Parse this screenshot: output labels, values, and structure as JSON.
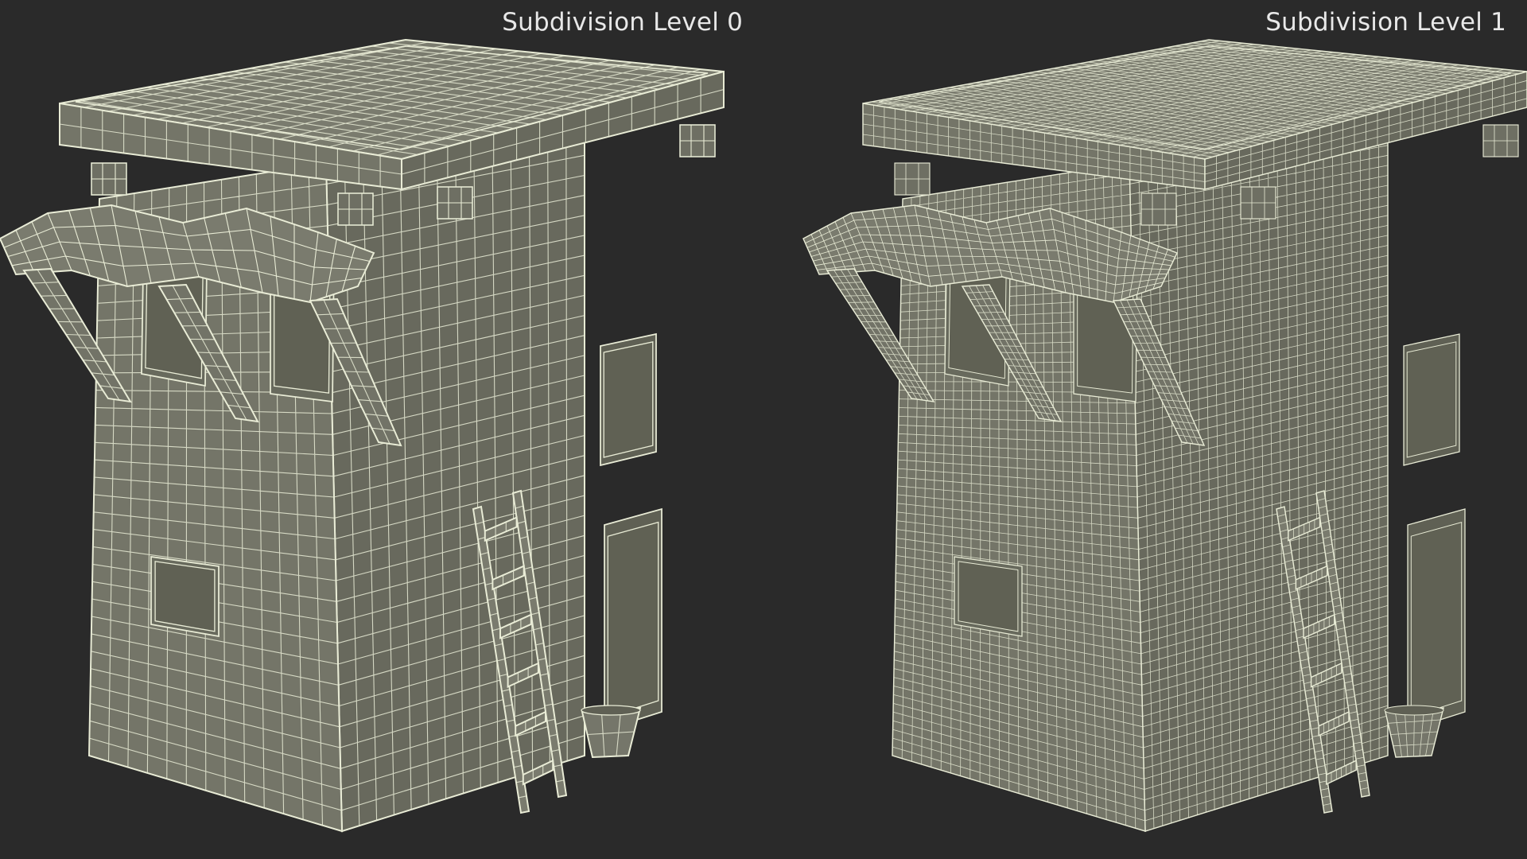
{
  "captions": {
    "left": "Subdivision Level 0",
    "right": "Subdivision Level 1"
  },
  "colors": {
    "background": "#2a2a2a",
    "wall_front": "#747568",
    "wall_side": "#68695d",
    "roof_top": "#7a7b6e",
    "wire": "#e9ecd6",
    "caption": "#e8e8e8"
  },
  "models": [
    {
      "name": "building-level-0",
      "subdivision_level": 0
    },
    {
      "name": "building-level-1",
      "subdivision_level": 1
    }
  ]
}
